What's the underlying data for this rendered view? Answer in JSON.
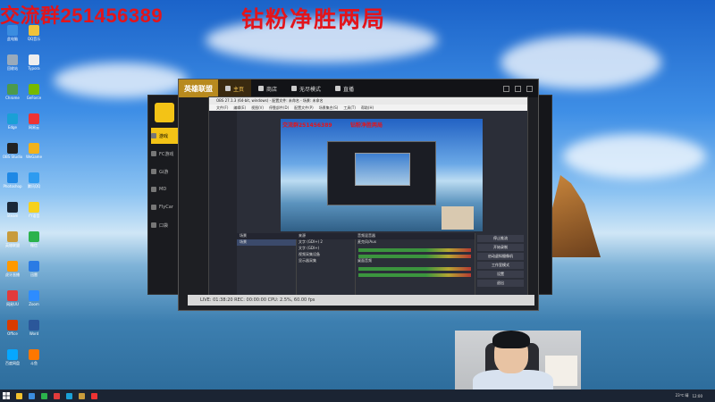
{
  "overlay": {
    "group_text": "交流群251456389",
    "banner_text": "钻粉净胜两局"
  },
  "desktop": {
    "icons": [
      {
        "name": "此电脑",
        "color": "#3b8de0"
      },
      {
        "name": "QQ音乐",
        "color": "#f0c23a"
      },
      {
        "name": "回收站",
        "color": "#9ab"
      },
      {
        "name": "Typora",
        "color": "#eee"
      },
      {
        "name": "Chrome",
        "color": "#4c9a4c"
      },
      {
        "name": "GeForce",
        "color": "#76b900"
      },
      {
        "name": "Edge",
        "color": "#1aa0d6"
      },
      {
        "name": "网易云",
        "color": "#e33"
      },
      {
        "name": "OBS Studio",
        "color": "#222"
      },
      {
        "name": "WeGame",
        "color": "#f2b21a"
      },
      {
        "name": "Photoshop",
        "color": "#1e88e5"
      },
      {
        "name": "腾讯QQ",
        "color": "#2e9bf0"
      },
      {
        "name": "Steam",
        "color": "#1b2838"
      },
      {
        "name": "YY语音",
        "color": "#f6d11c"
      },
      {
        "name": "英雄联盟",
        "color": "#c89b3c"
      },
      {
        "name": "微信",
        "color": "#2bb24c"
      },
      {
        "name": "虎牙直播",
        "color": "#ff9900"
      },
      {
        "name": "迅雷",
        "color": "#2a7be4"
      },
      {
        "name": "网易UU",
        "color": "#e23b3b"
      },
      {
        "name": "Zoom",
        "color": "#2d8cff"
      },
      {
        "name": "Office",
        "color": "#d83b01"
      },
      {
        "name": "Word",
        "color": "#2b579a"
      },
      {
        "name": "百度网盘",
        "color": "#06a7ff"
      },
      {
        "name": "斗鱼",
        "color": "#ff7700"
      }
    ]
  },
  "client": {
    "brand": "英雄联盟",
    "tabs": [
      {
        "label": "主页",
        "active": true
      },
      {
        "label": "商店",
        "active": false
      },
      {
        "label": "无尽模式",
        "active": false
      },
      {
        "label": "直播",
        "active": false
      }
    ]
  },
  "launcher": {
    "items": [
      "游戏",
      "FC游戏",
      "Gi游",
      "MD",
      "FlyCar",
      "口袋"
    ]
  },
  "obs": {
    "title": "OBS 27.1.3 (64-bit, windows) - 配置文件: 未命名 - 场景: 未命名",
    "menu": [
      "文件(F)",
      "编辑(E)",
      "视图(V)",
      "停靠部件(D)",
      "配置文件(P)",
      "场景集合(S)",
      "工具(T)",
      "帮助(H)"
    ],
    "preview_text_left": "交流群251456389",
    "preview_text_right": "钻粉净胜两局",
    "scene_header": "场景",
    "scenes": [
      "场景"
    ],
    "sources_header": "来源",
    "sources": [
      "文字 (GDI+) 2",
      "文字 (GDI+)",
      "视频采集设备",
      "显示器采集"
    ],
    "mixer_header": "音频混音器",
    "mixer_tracks": [
      "麦克风/Aux",
      "桌面音频"
    ],
    "controls": [
      "停止推流",
      "开始录制",
      "启动虚拟摄像机",
      "工作室模式",
      "设置",
      "退出"
    ],
    "status": "LIVE: 01:38:20  REC: 00:00:00  CPU: 2.5%, 60.00 fps"
  },
  "taskbar": {
    "apps": [
      "#f2c12e",
      "#3b8de0",
      "#2bb24c",
      "#e23b3b",
      "#1aa0d6",
      "#c89b3c",
      "#e33"
    ],
    "tray_text": "23℃ 晴",
    "clock": "12:00"
  }
}
